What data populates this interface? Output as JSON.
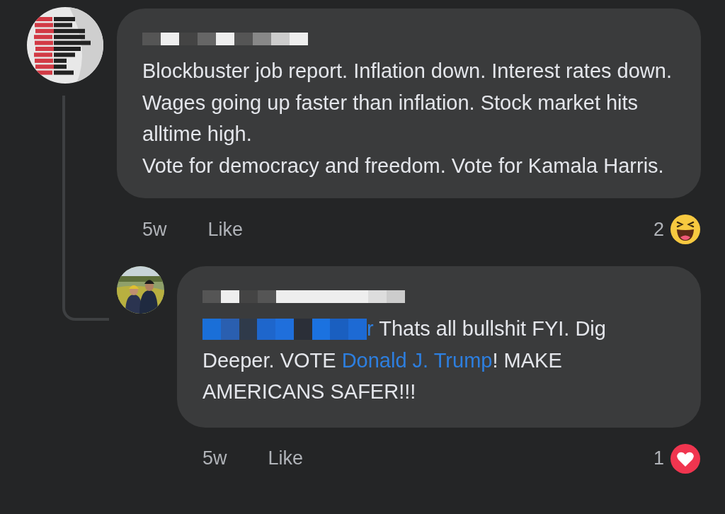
{
  "comments": [
    {
      "segments": [
        {
          "kind": "text",
          "text": "Blockbuster job report. Inflation down. Interest rates down. Wages going up faster than inflation. Stock market hits alltime high.\nVote for democracy and freedom. Vote for Kamala Harris."
        }
      ],
      "time": "5w",
      "like": "Like",
      "reaction": {
        "kind": "haha",
        "count": "2"
      }
    },
    {
      "segments": [
        {
          "kind": "redacted"
        },
        {
          "kind": "link",
          "text": "r"
        },
        {
          "kind": "text",
          "text": " Thats all bullshit FYI. Dig Deeper. VOTE "
        },
        {
          "kind": "link",
          "text": "Donald J. Trump"
        },
        {
          "kind": "text",
          "text": "!  MAKE AMERICANS SAFER!!!"
        }
      ],
      "time": "5w",
      "like": "Like",
      "reaction": {
        "kind": "love",
        "count": "1"
      }
    }
  ]
}
